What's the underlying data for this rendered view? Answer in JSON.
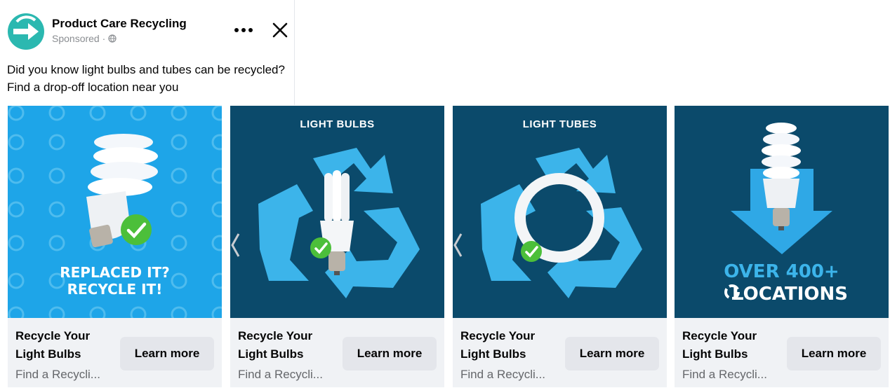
{
  "post": {
    "page_name": "Product Care Recycling",
    "sponsored": "Sponsored ·",
    "text": "Did you know light bulbs and tubes can be recycled? Find a drop-off location near you",
    "brand_color": "#2bb8b0"
  },
  "icons": {
    "more": "more-options-icon",
    "close": "close-icon",
    "globe": "globe-icon"
  },
  "cards": [
    {
      "image_text_line1": "REPLACED IT?",
      "image_text_line2": "RECYCLE IT!",
      "title": "Recycle Your Light Bulbs",
      "description": "Find a Recycli...",
      "cta": "Learn more",
      "bg": "#1ea5e8"
    },
    {
      "image_label": "LIGHT BULBS",
      "title": "Recycle Your Light Bulbs",
      "description": "Find a Recycli...",
      "cta": "Learn more",
      "bg": "#0b4a6b"
    },
    {
      "image_label": "LIGHT TUBES",
      "title": "Recycle Your Light Bulbs",
      "description": "Find a Recycli...",
      "cta": "Learn more",
      "bg": "#0b4a6b"
    },
    {
      "image_text_line1": "OVER 400+",
      "image_text_line2": "LOCATIONS",
      "title": "Recycle Your Light Bulbs",
      "description": "Find a Recycli...",
      "cta": "Learn more",
      "bg": "#0b4a6b"
    }
  ],
  "colors": {
    "recycle_blue": "#3cb4ea",
    "check_green": "#4cbf3a",
    "highlight_blue": "#2fa8e6"
  }
}
